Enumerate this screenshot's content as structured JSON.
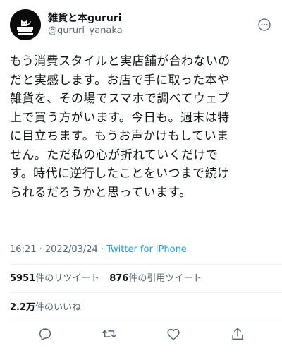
{
  "author": {
    "display_name": "雑貨と本gururi",
    "handle": "@gururi_yanaka",
    "avatar_icon": "cat-on-books-logo-icon"
  },
  "tweet": {
    "lines": [
      "もう消費スタイルと実店舗が合わないの",
      "だと実感します。お店で手に取った本や",
      "雑貨を、その場でスマホで調べてウェブ",
      "上で買う方がいます。今日も。週末は特",
      "に目立ちます。もうお声かけもしていま",
      "せん。ただ私の心が折れていくだけで",
      "す。時代に逆行したことをいつまで続け",
      "られるだろうかと思っています。"
    ]
  },
  "meta": {
    "time": "16:21",
    "separator": " · ",
    "date": "2022/03/24",
    "source": "Twitter for iPhone"
  },
  "stats": {
    "retweets_count": "5951",
    "retweets_label": "件のリツイート",
    "quotes_count": "876",
    "quotes_label": "件の引用ツイート",
    "likes_count": "2.2万",
    "likes_label": "件のいいね"
  },
  "actions": {
    "reply": "reply-icon",
    "retweet": "retweet-icon",
    "like": "heart-icon",
    "share": "share-icon"
  },
  "colors": {
    "text": "#0f1419",
    "secondary": "#536471",
    "link": "#1d9bf0",
    "divider": "#eff3f4"
  }
}
